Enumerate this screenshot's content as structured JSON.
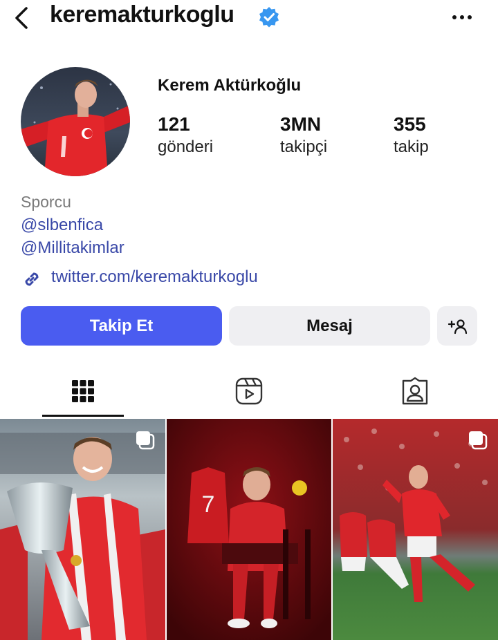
{
  "header": {
    "username": "keremakturkoglu",
    "back_icon": "chevron-left-icon",
    "verified_icon": "verified-badge-icon",
    "more_icon": "more-horizontal-icon"
  },
  "profile": {
    "full_name": "Kerem Aktürkoğlu",
    "stats": [
      {
        "value": "121",
        "label": "gönderi"
      },
      {
        "value": "3MN",
        "label": "takipçi"
      },
      {
        "value": "355",
        "label": "takip"
      }
    ],
    "category": "Sporcu",
    "mentions": [
      "@slbenfica",
      "@Millitakimlar"
    ],
    "link": "twitter.com/keremakturkoglu"
  },
  "actions": {
    "follow_label": "Takip Et",
    "message_label": "Mesaj",
    "add_user_icon": "add-user-icon"
  },
  "tabs": [
    {
      "icon": "grid-icon",
      "active": true
    },
    {
      "icon": "reels-icon",
      "active": false
    },
    {
      "icon": "tagged-icon",
      "active": false
    }
  ],
  "colors": {
    "accent": "#4a5cf0",
    "link": "#3a49a8",
    "verified": "#3897f0",
    "secondary_button": "#efeff2"
  }
}
